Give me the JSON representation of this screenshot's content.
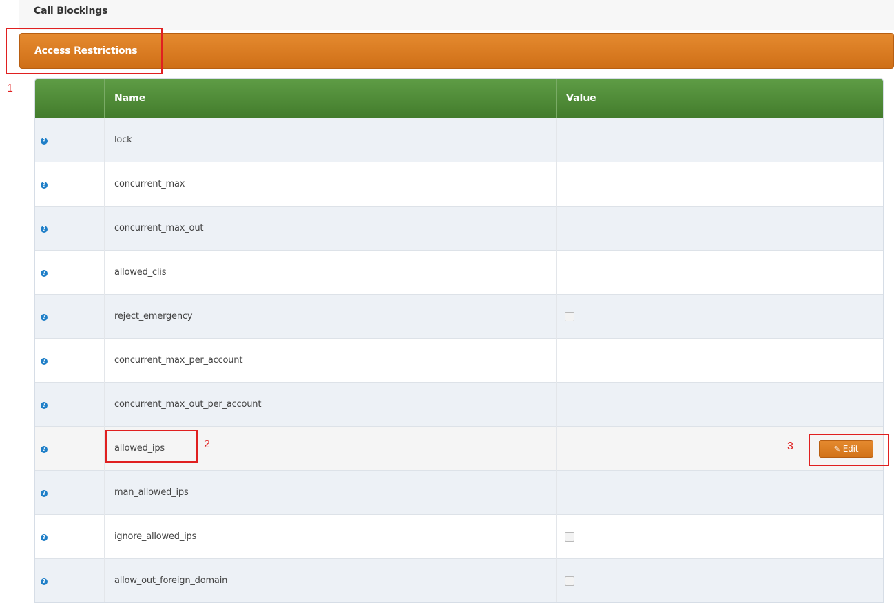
{
  "sections": {
    "call_blockings": "Call Blockings",
    "access_restrictions": "Access Restrictions"
  },
  "table": {
    "headers": [
      "",
      "Name",
      "Value",
      ""
    ],
    "rows": [
      {
        "name": "lock",
        "value": ""
      },
      {
        "name": "concurrent_max",
        "value": ""
      },
      {
        "name": "concurrent_max_out",
        "value": ""
      },
      {
        "name": "allowed_clis",
        "value": ""
      },
      {
        "name": "reject_emergency",
        "value": "checkbox-unchecked"
      },
      {
        "name": "concurrent_max_per_account",
        "value": ""
      },
      {
        "name": "concurrent_max_out_per_account",
        "value": ""
      },
      {
        "name": "allowed_ips",
        "value": ""
      },
      {
        "name": "man_allowed_ips",
        "value": ""
      },
      {
        "name": "ignore_allowed_ips",
        "value": "checkbox-unchecked"
      },
      {
        "name": "allow_out_foreign_domain",
        "value": "checkbox-unchecked"
      }
    ]
  },
  "help_icon": "question-circle-icon",
  "edit_button": {
    "label": "Edit",
    "icon": "edit-icon"
  },
  "annotations": [
    "1",
    "2",
    "3"
  ],
  "colors": {
    "accent_orange": "#d97a21",
    "header_green": "#4f8a37",
    "annotation_red": "#e02020",
    "help_blue": "#1f7fc8"
  }
}
